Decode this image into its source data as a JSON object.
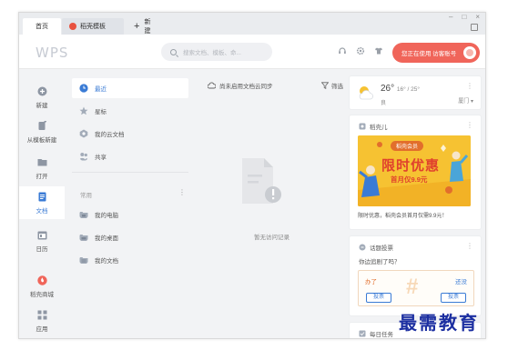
{
  "tabs": {
    "home": "首页",
    "doc": "稻壳模板",
    "new": "新建"
  },
  "window_controls": {
    "minimize": "–",
    "maximize": "□",
    "close": "×"
  },
  "header": {
    "logo": "WPS",
    "search_placeholder": "搜索文档、模板、命...",
    "user_label": "您正在使用 访客账号"
  },
  "rail": {
    "items": [
      {
        "label": "新建",
        "icon": "plus-circle-icon"
      },
      {
        "label": "从模板新建",
        "icon": "template-icon"
      },
      {
        "label": "打开",
        "icon": "folder-icon"
      },
      {
        "label": "文档",
        "icon": "document-icon",
        "active": true
      },
      {
        "label": "日历",
        "icon": "calendar-icon"
      },
      {
        "label": "稻壳商城",
        "icon": "store-icon"
      },
      {
        "label": "应用",
        "icon": "apps-icon"
      }
    ]
  },
  "nav": {
    "items": [
      {
        "label": "最近",
        "icon": "clock-icon",
        "active": true
      },
      {
        "label": "星标",
        "icon": "star-icon"
      },
      {
        "label": "我的云文档",
        "icon": "cloud-doc-icon"
      },
      {
        "label": "共享",
        "icon": "share-icon"
      }
    ],
    "section_label": "常用",
    "common": [
      {
        "label": "我的电脑",
        "icon": "computer-icon"
      },
      {
        "label": "我的桌面",
        "icon": "desktop-icon"
      },
      {
        "label": "我的文档",
        "icon": "folder-icon"
      }
    ]
  },
  "main": {
    "sync_text": "尚未启用文档云同步",
    "filter_label": "筛选",
    "empty_text": "暂无访问记录"
  },
  "weather": {
    "temp": "26°",
    "range": "16° / 25°",
    "condition": "良",
    "city": "厦门"
  },
  "promo": {
    "title": "稻壳儿",
    "tag": "稻壳会员",
    "headline": "限时优惠",
    "subline": "首月仅9.9元",
    "caption": "限时优惠，稻壳会员首月仅需9.9元！"
  },
  "poll": {
    "title": "话题投票",
    "question": "你边追剧了吗？",
    "option_a": "办了",
    "option_b": "还没",
    "vote_a": "投票",
    "vote_b": "投票"
  },
  "task": {
    "title": "每日任务"
  },
  "watermark": "最需教育",
  "colors": {
    "accent": "#3a7bd5",
    "brand_red": "#f0655a",
    "promo_yellow": "#f6c232"
  }
}
